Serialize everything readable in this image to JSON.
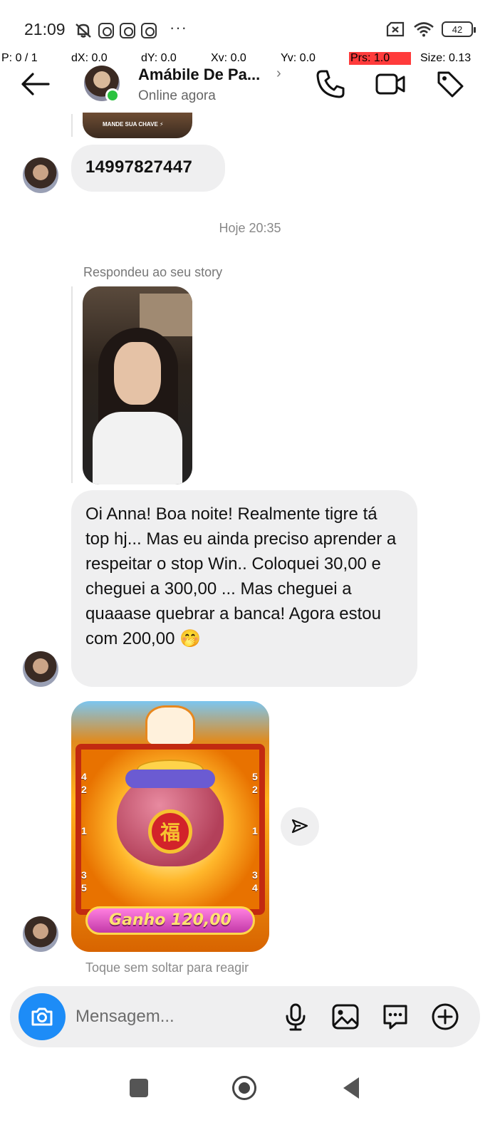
{
  "status_bar": {
    "time": "21:09",
    "battery": "42",
    "more": "···"
  },
  "debug_overlay": {
    "p": "P: 0 / 1",
    "dx": "dX: 0.0",
    "dy": "dY: 0.0",
    "xv": "Xv: 0.0",
    "yv": "Yv: 0.0",
    "prs": "Prs: 1.0",
    "size": "Size: 0.13"
  },
  "header": {
    "contact_name": "Amábile De Pa...",
    "chevron": "›",
    "status": "Online agora",
    "icons": [
      "back-arrow-icon",
      "phone-icon",
      "video-icon",
      "tag-icon"
    ]
  },
  "chat": {
    "story_thumb_caption": "MANDE SUA CHAVE ⚡",
    "number_message": "14997827447",
    "time_separator": "Hoje 20:35",
    "reply_label": "Respondeu ao seu story",
    "long_message": "Oi Anna! Boa noite! Realmente tigre tá top hj... Mas eu ainda preciso aprender a respeitar o stop Win.. Coloquei 30,00 e cheguei a 300,00 ... Mas cheguei a quaaase quebrar a banca! Agora estou com 200,00 🤭",
    "game_win_text": "Ganho 120,00",
    "game_seal_char": "福",
    "game_left_numbers": [
      "4",
      "2",
      "1",
      "3",
      "5"
    ],
    "game_right_numbers": [
      "5",
      "2",
      "1",
      "3",
      "4"
    ],
    "hint": "Toque sem soltar para reagir"
  },
  "composer": {
    "placeholder": "Mensagem...",
    "icons": [
      "camera-icon",
      "microphone-icon",
      "gallery-icon",
      "sticker-icon",
      "plus-icon"
    ]
  },
  "colors": {
    "accent_blue": "#1d8cf7",
    "online_green": "#2bc23f",
    "bubble_gray": "#efeff0",
    "debug_red": "#ff3b3b"
  }
}
